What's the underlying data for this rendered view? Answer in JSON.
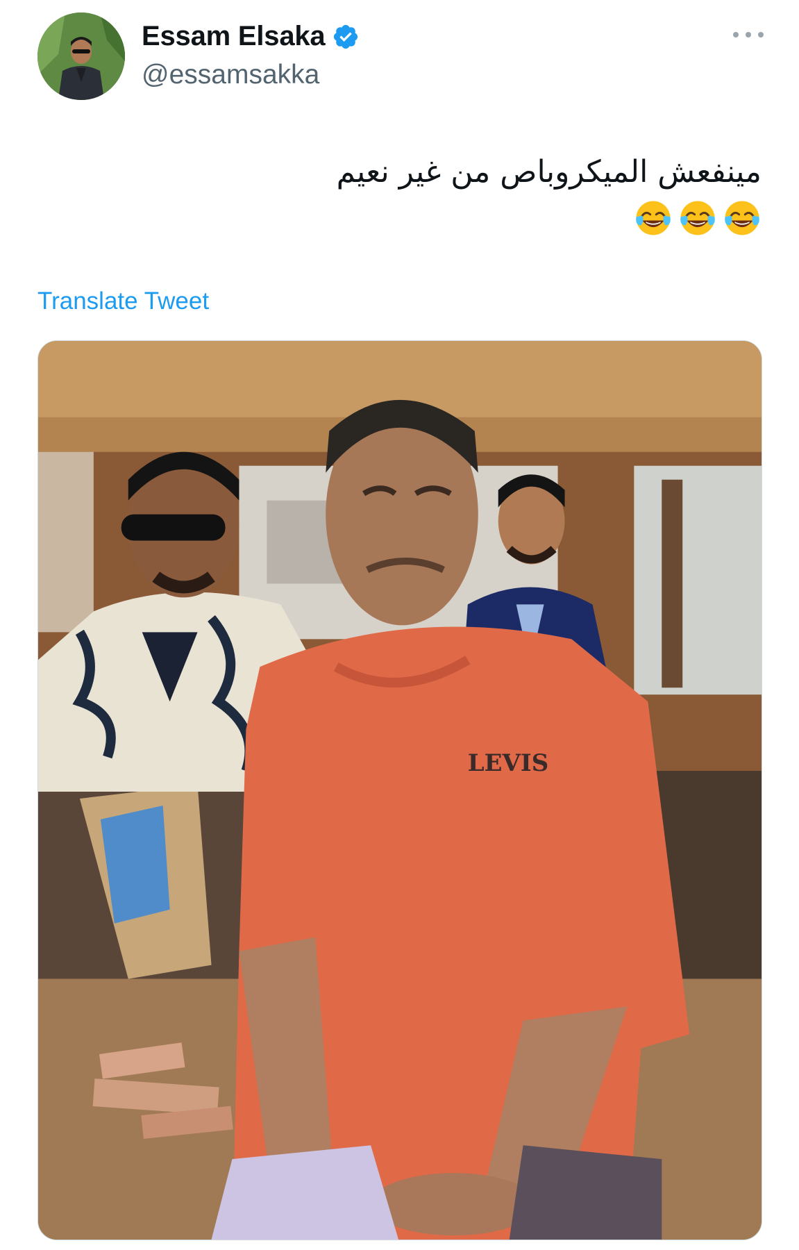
{
  "author": {
    "display_name": "Essam Elsaka",
    "handle": "@essamsakka",
    "verified": true,
    "avatar_icon": "profile-photo"
  },
  "tweet": {
    "text": "مينفعش الميكروباص من غير نعيم",
    "emojis": [
      "face-with-tears-of-joy",
      "face-with-tears-of-joy",
      "face-with-tears-of-joy"
    ],
    "translate_label": "Translate Tweet"
  },
  "media": {
    "type": "photo",
    "shirt_logo_text": "LEVIS"
  },
  "colors": {
    "link": "#1d9bf0",
    "verified_badge": "#1d9bf0",
    "secondary_text": "#536471"
  }
}
